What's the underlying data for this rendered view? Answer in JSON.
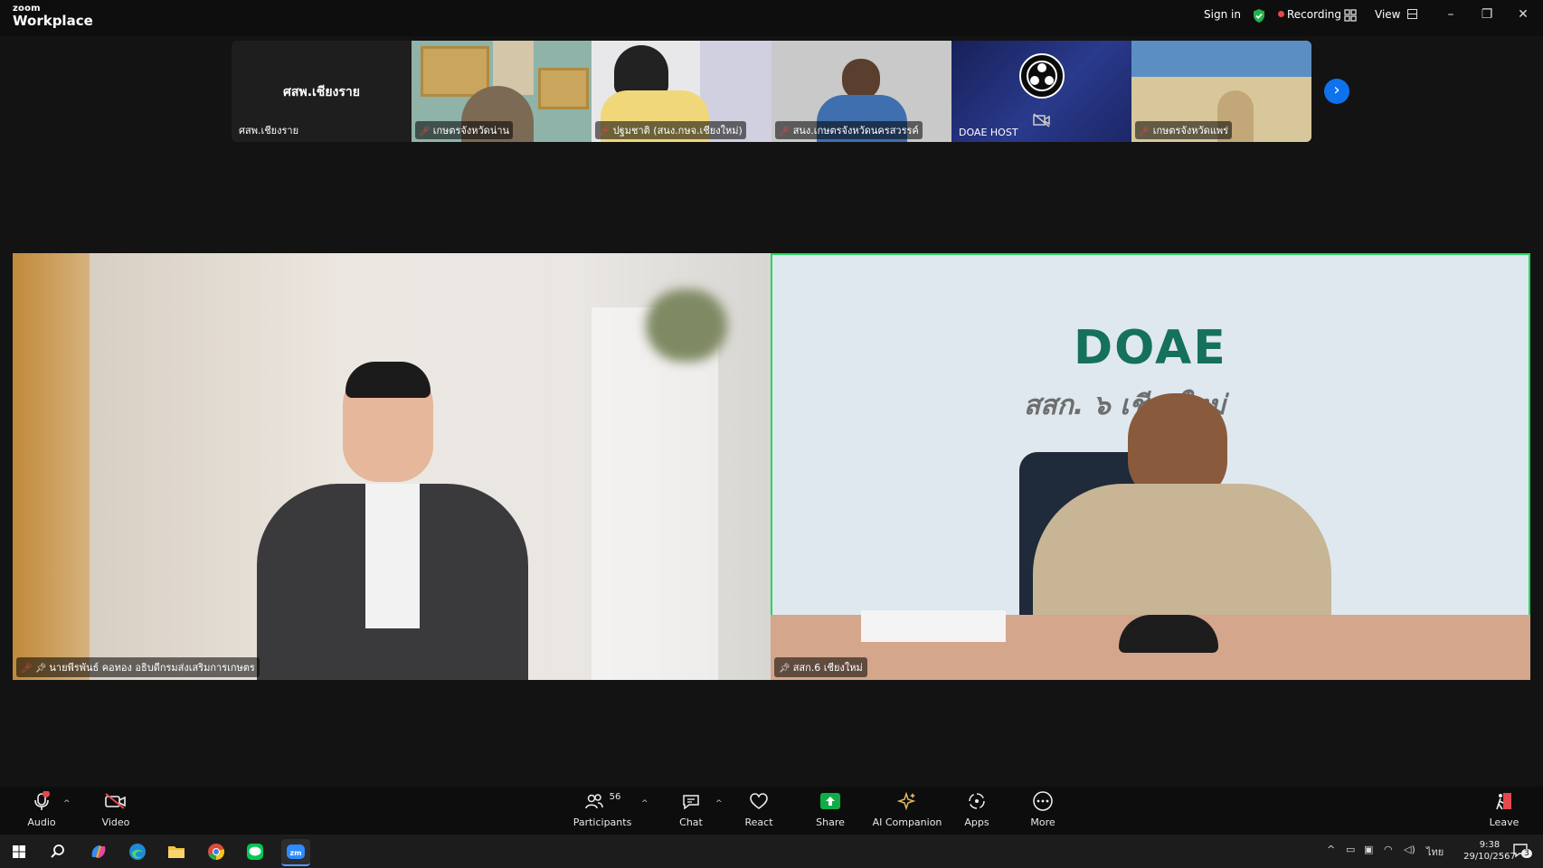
{
  "app": {
    "brand_small": "zoom",
    "brand_big": "Workplace"
  },
  "titlebar": {
    "sign_in": "Sign in",
    "recording": "Recording",
    "view": "View"
  },
  "strip": [
    {
      "name": "ศสพ.เชียงราย",
      "center_label": "ศสพ.เชียงราย"
    },
    {
      "name": "เกษตรจังหวัดน่าน"
    },
    {
      "name": "ปฐมชาติ (สนง.กษจ.เชียงใหม่)"
    },
    {
      "name": "สนง.เกษตรจังหวัดนครสวรรค์"
    },
    {
      "name": "DOAE HOST"
    },
    {
      "name": "เกษตรจังหวัดแพร่"
    }
  ],
  "main": {
    "left_name": "นายพีรพันธ์ คอทอง อธิบดีกรมส่งเสริมการเกษตร",
    "right_name": "สสก.6 เชียงใหม่",
    "right_sign_logo": "DOAE",
    "right_sign_text": "สสก. ๖ เชียงใหม่"
  },
  "toolbar": {
    "audio": "Audio",
    "video": "Video",
    "participants": "Participants",
    "participants_count": "56",
    "chat": "Chat",
    "react": "React",
    "share": "Share",
    "ai_companion": "AI Companion",
    "apps": "Apps",
    "more": "More",
    "leave": "Leave"
  },
  "taskbar": {
    "lang": "ไทย",
    "time": "9:38",
    "date": "29/10/2567",
    "notifications": "3"
  },
  "colors": {
    "accent": "#0e72ed",
    "active_speaker": "#23d959",
    "share": "#0ead47",
    "muted": "#e5484d"
  }
}
